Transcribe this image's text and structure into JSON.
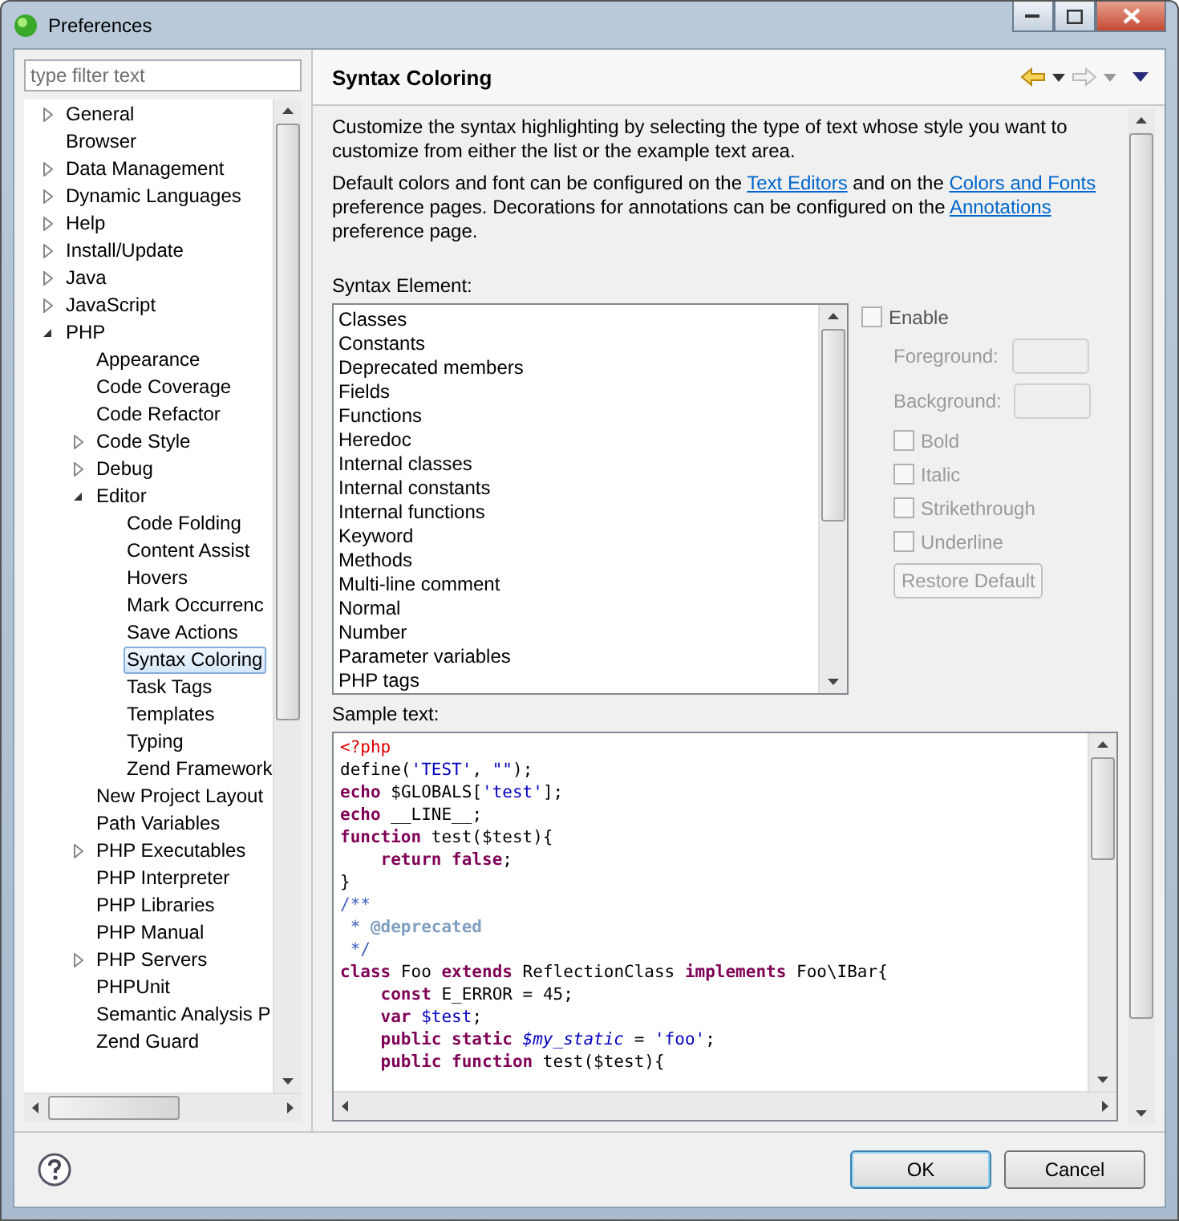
{
  "window": {
    "title": "Preferences"
  },
  "filter": {
    "placeholder": "type filter text"
  },
  "tree": [
    {
      "label": "General",
      "expanded": false,
      "selected": false
    },
    {
      "label": "Browser",
      "selected": false
    },
    {
      "label": "Data Management",
      "expanded": false,
      "selected": false
    },
    {
      "label": "Dynamic Languages",
      "expanded": false,
      "selected": false
    },
    {
      "label": "Help",
      "expanded": false,
      "selected": false
    },
    {
      "label": "Install/Update",
      "expanded": false,
      "selected": false
    },
    {
      "label": "Java",
      "expanded": false,
      "selected": false
    },
    {
      "label": "JavaScript",
      "expanded": false,
      "selected": false
    },
    {
      "label": "PHP",
      "expanded": true,
      "selected": false,
      "children": [
        {
          "label": "Appearance",
          "selected": false
        },
        {
          "label": "Code Coverage",
          "selected": false
        },
        {
          "label": "Code Refactor",
          "selected": false
        },
        {
          "label": "Code Style",
          "expanded": false,
          "selected": false
        },
        {
          "label": "Debug",
          "expanded": false,
          "selected": false
        },
        {
          "label": "Editor",
          "expanded": true,
          "selected": false,
          "children": [
            {
              "label": "Code Folding",
              "selected": false
            },
            {
              "label": "Content Assist",
              "selected": false
            },
            {
              "label": "Hovers",
              "selected": false
            },
            {
              "label": "Mark Occurrenc",
              "selected": false
            },
            {
              "label": "Save Actions",
              "selected": false
            },
            {
              "label": "Syntax Coloring",
              "selected": true
            },
            {
              "label": "Task Tags",
              "selected": false
            },
            {
              "label": "Templates",
              "selected": false
            },
            {
              "label": "Typing",
              "selected": false
            },
            {
              "label": "Zend Framework",
              "selected": false
            }
          ]
        },
        {
          "label": "New Project Layout",
          "selected": false
        },
        {
          "label": "Path Variables",
          "selected": false
        },
        {
          "label": "PHP Executables",
          "expanded": false,
          "selected": false
        },
        {
          "label": "PHP Interpreter",
          "selected": false
        },
        {
          "label": "PHP Libraries",
          "selected": false
        },
        {
          "label": "PHP Manual",
          "selected": false
        },
        {
          "label": "PHP Servers",
          "expanded": false,
          "selected": false
        },
        {
          "label": "PHPUnit",
          "selected": false
        },
        {
          "label": "Semantic Analysis P",
          "selected": false
        },
        {
          "label": "Zend Guard",
          "selected": false
        }
      ]
    }
  ],
  "page": {
    "title": "Syntax Coloring",
    "paragraphs": [
      [
        {
          "kind": "text",
          "text": "Customize the syntax highlighting by selecting the type of text whose style you want to customize from either the list or the example text area."
        }
      ],
      [
        {
          "kind": "text",
          "text": "Default colors and font can be configured on the "
        },
        {
          "kind": "link",
          "text": "Text Editors"
        },
        {
          "kind": "text",
          "text": " and on the "
        },
        {
          "kind": "link",
          "text": "Colors and Fonts"
        },
        {
          "kind": "text",
          "text": " preference pages.  Decorations for annotations can be configured on the "
        },
        {
          "kind": "link",
          "text": "Annotations"
        },
        {
          "kind": "text",
          "text": " preference page."
        }
      ]
    ],
    "syntax_label": "Syntax Element:",
    "syntax_items": [
      {
        "label": "Classes",
        "selected": false
      },
      {
        "label": "Constants",
        "selected": false
      },
      {
        "label": "Deprecated members",
        "selected": false
      },
      {
        "label": "Fields",
        "selected": false
      },
      {
        "label": "Functions",
        "selected": false
      },
      {
        "label": "Heredoc",
        "selected": false
      },
      {
        "label": "Internal classes",
        "selected": false
      },
      {
        "label": "Internal constants",
        "selected": false
      },
      {
        "label": "Internal functions",
        "selected": false
      },
      {
        "label": "Keyword",
        "selected": false
      },
      {
        "label": "Methods",
        "selected": false
      },
      {
        "label": "Multi-line comment",
        "selected": false
      },
      {
        "label": "Normal",
        "selected": false
      },
      {
        "label": "Number",
        "selected": false
      },
      {
        "label": "Parameter variables",
        "selected": false
      },
      {
        "label": "PHP tags",
        "selected": false
      }
    ],
    "enable": {
      "label": "Enable",
      "checked": false,
      "disabled": false
    },
    "color_fields": [
      {
        "label": "Foreground:",
        "disabled": true
      },
      {
        "label": "Background:",
        "disabled": true
      }
    ],
    "style_options": [
      {
        "label": "Bold",
        "checked": false,
        "disabled": true
      },
      {
        "label": "Italic",
        "checked": false,
        "disabled": true
      },
      {
        "label": "Strikethrough",
        "checked": false,
        "disabled": true
      },
      {
        "label": "Underline",
        "checked": false,
        "disabled": true
      }
    ],
    "restore_button": {
      "label": "Restore Default",
      "disabled": true
    },
    "sample_label": "Sample text:",
    "sample_lines": [
      [
        {
          "kind": "tag",
          "text": "<?php"
        }
      ],
      [
        {
          "kind": "plain",
          "text": "define("
        },
        {
          "kind": "string",
          "text": "'TEST'"
        },
        {
          "kind": "plain",
          "text": ", "
        },
        {
          "kind": "string",
          "text": "\"\""
        },
        {
          "kind": "plain",
          "text": ");"
        }
      ],
      [
        {
          "kind": "keyword",
          "text": "echo"
        },
        {
          "kind": "plain",
          "text": " $GLOBALS["
        },
        {
          "kind": "string",
          "text": "'test'"
        },
        {
          "kind": "plain",
          "text": "];"
        }
      ],
      [
        {
          "kind": "keyword",
          "text": "echo"
        },
        {
          "kind": "plain",
          "text": " __LINE__;"
        }
      ],
      [
        {
          "kind": "keyword",
          "text": "function"
        },
        {
          "kind": "plain",
          "text": " test($test){"
        }
      ],
      [
        {
          "kind": "keyword",
          "text": "    return false"
        },
        {
          "kind": "plain",
          "text": ";"
        }
      ],
      [
        {
          "kind": "plain",
          "text": "}"
        }
      ],
      [
        {
          "kind": "comment",
          "text": "/**"
        }
      ],
      [
        {
          "kind": "comment",
          "text": " * "
        },
        {
          "kind": "doctag",
          "text": "@deprecated"
        }
      ],
      [
        {
          "kind": "comment",
          "text": " */"
        }
      ],
      [
        {
          "kind": "keyword",
          "text": "class"
        },
        {
          "kind": "plain",
          "text": " Foo "
        },
        {
          "kind": "keyword",
          "text": "extends"
        },
        {
          "kind": "plain",
          "text": " ReflectionClass "
        },
        {
          "kind": "keyword",
          "text": "implements"
        },
        {
          "kind": "plain",
          "text": " Foo\\IBar{"
        }
      ],
      [
        {
          "kind": "keyword",
          "text": "    const"
        },
        {
          "kind": "plain",
          "text": " E_ERROR = 45;"
        }
      ],
      [
        {
          "kind": "keyword",
          "text": "    var"
        },
        {
          "kind": "variable",
          "text": " $test"
        },
        {
          "kind": "plain",
          "text": ";"
        }
      ],
      [
        {
          "kind": "keyword",
          "text": "    public static"
        },
        {
          "kind": "static",
          "text": " $my_static"
        },
        {
          "kind": "plain",
          "text": " = "
        },
        {
          "kind": "string",
          "text": "'foo'"
        },
        {
          "kind": "plain",
          "text": ";"
        }
      ],
      [
        {
          "kind": "keyword",
          "text": "    public function"
        },
        {
          "kind": "plain",
          "text": " test($test){"
        }
      ]
    ]
  },
  "buttons": [
    {
      "label": "OK",
      "default": true
    },
    {
      "label": "Cancel",
      "default": false
    }
  ]
}
